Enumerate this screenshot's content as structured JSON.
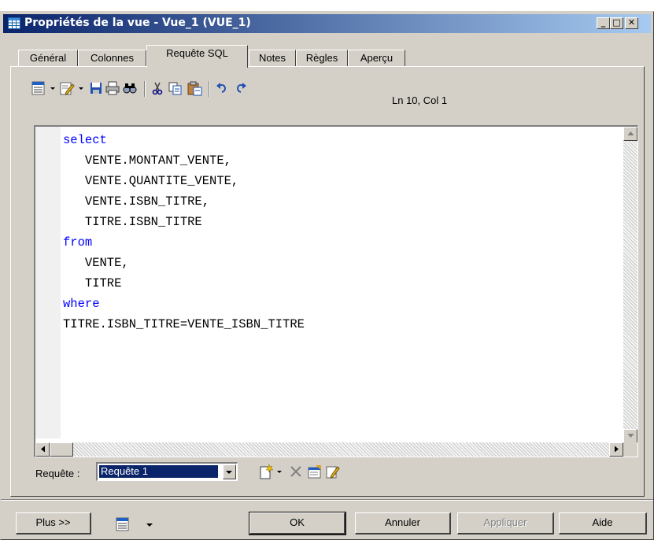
{
  "window": {
    "title": "Propriétés de la vue - Vue_1 (VUE_1)",
    "caption_buttons": {
      "minimize": "_",
      "maximize": "□",
      "close": "✕"
    }
  },
  "tabs": [
    {
      "label": "Général",
      "active": false
    },
    {
      "label": "Colonnes",
      "active": false
    },
    {
      "label": "Requête SQL",
      "active": true
    },
    {
      "label": "Notes",
      "active": false
    },
    {
      "label": "Règles",
      "active": false
    },
    {
      "label": "Aperçu",
      "active": false
    }
  ],
  "toolbar": {
    "icons": [
      "properties-icon",
      "dropdown-arrow-icon",
      "edit-icon",
      "dropdown-arrow-icon",
      "save-icon",
      "print-icon",
      "find-icon",
      "cut-icon",
      "copy-icon",
      "paste-icon",
      "undo-icon",
      "redo-icon"
    ],
    "cursor_position": "Ln 10, Col 1"
  },
  "editor": {
    "lines": [
      {
        "text": "select",
        "keyword": true
      },
      {
        "text": "   VENTE.MONTANT_VENTE,",
        "keyword": false
      },
      {
        "text": "   VENTE.QUANTITE_VENTE,",
        "keyword": false
      },
      {
        "text": "   VENTE.ISBN_TITRE,",
        "keyword": false
      },
      {
        "text": "   TITRE.ISBN_TITRE",
        "keyword": false
      },
      {
        "text": "from",
        "keyword": true
      },
      {
        "text": "   VENTE,",
        "keyword": false
      },
      {
        "text": "   TITRE",
        "keyword": false
      },
      {
        "text": "where",
        "keyword": true
      },
      {
        "text": "TITRE.ISBN_TITRE=VENTE_ISBN_TITRE",
        "keyword": false
      }
    ],
    "keyword_color": "#0000ff"
  },
  "query": {
    "label": "Requête :",
    "selected": "Requête 1"
  },
  "buttons": {
    "more": "Plus >>",
    "ok": "OK",
    "cancel": "Annuler",
    "apply": "Appliquer",
    "help": "Aide"
  },
  "colors": {
    "titlebar_start": "#0a246a",
    "titlebar_end": "#a6caf0",
    "face": "#d4d0c8"
  }
}
